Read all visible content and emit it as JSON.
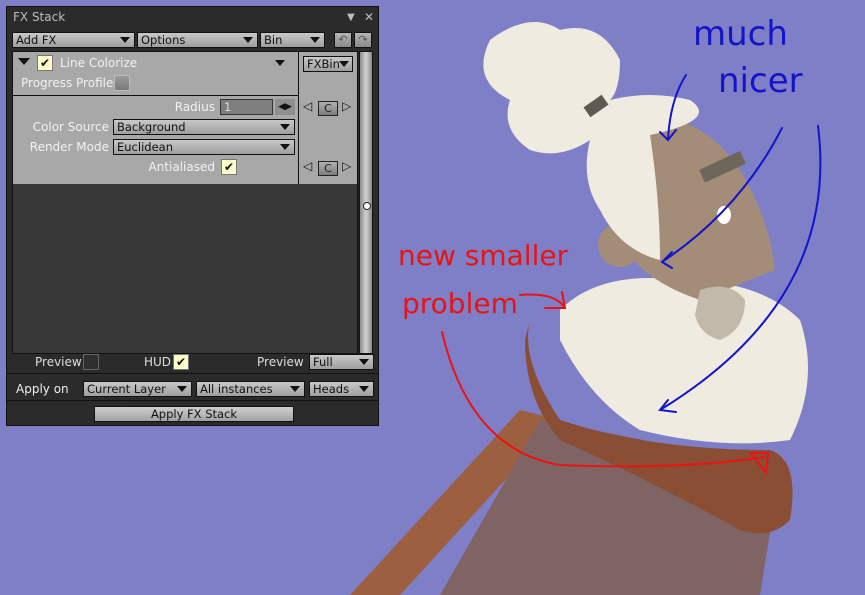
{
  "panel": {
    "title": "FX Stack",
    "toolbar": {
      "add_fx": "Add FX",
      "options": "Options",
      "bin": "Bin"
    },
    "fx": {
      "name": "Line Colorize",
      "enabled": true,
      "bin_button": "FXBin",
      "progress_profile_label": "Progress Profile",
      "params": {
        "radius_label": "Radius",
        "radius_value": "1",
        "color_source_label": "Color Source",
        "color_source_value": "Background",
        "render_mode_label": "Render Mode",
        "render_mode_value": "Euclidean",
        "antialiased_label": "Antialiased",
        "antialiased": true
      },
      "keyframe_c_label": "C"
    },
    "footer": {
      "preview_label": "Preview",
      "hud_label": "HUD",
      "hud_checked": true,
      "preview_mode_label": "Preview",
      "preview_mode_value": "Full",
      "apply_on_label": "Apply on",
      "apply_layer": "Current Layer",
      "apply_instances": "All instances",
      "apply_heads": "Heads",
      "apply_button": "Apply FX Stack"
    }
  },
  "canvas": {
    "background_color": "#7f7fc8",
    "annotations": {
      "blue_text_line1": "much",
      "blue_text_line2": "nicer",
      "red_text_line1": "new smaller",
      "red_text_line2": "problem",
      "blue_color": "#1414c8",
      "red_color": "#e81414"
    }
  }
}
